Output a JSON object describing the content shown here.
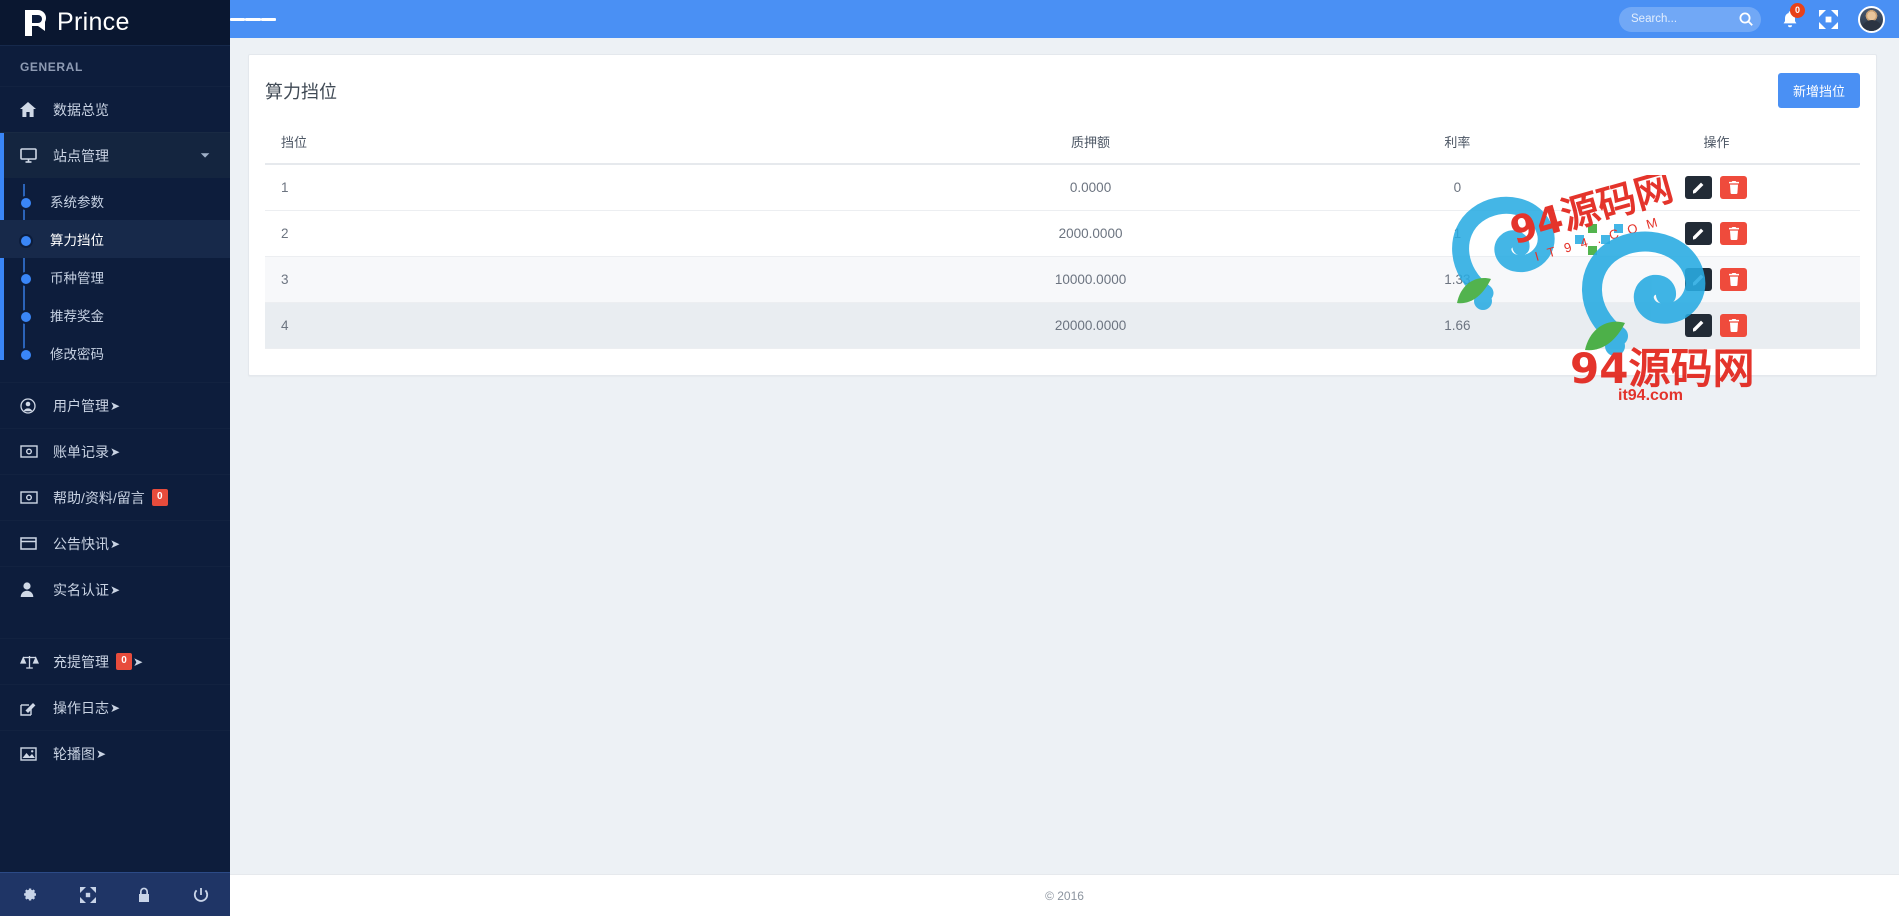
{
  "brand": {
    "name": "Prince"
  },
  "sidebar": {
    "section_label": "GENERAL",
    "items": [
      {
        "label": "数据总览",
        "icon": "home-icon",
        "caret": "",
        "badge": ""
      },
      {
        "label": "站点管理",
        "icon": "monitor-icon",
        "caret": "chevron-down",
        "badge": ""
      },
      {
        "label": "用户管理",
        "icon": "user-circle-icon",
        "caret": "chevron-right",
        "badge": ""
      },
      {
        "label": "账单记录",
        "icon": "money-icon",
        "caret": "chevron-right",
        "badge": ""
      },
      {
        "label": "帮助/资料/留言",
        "icon": "money-icon",
        "caret": "",
        "badge": "0"
      },
      {
        "label": "公告快讯",
        "icon": "window-icon",
        "caret": "chevron-right",
        "badge": ""
      },
      {
        "label": "实名认证",
        "icon": "person-icon",
        "caret": "chevron-right",
        "badge": ""
      },
      {
        "label": "充提管理",
        "icon": "balance-icon",
        "caret": "chevron-right",
        "badge": "0"
      },
      {
        "label": "操作日志",
        "icon": "edit-square-icon",
        "caret": "chevron-right",
        "badge": ""
      },
      {
        "label": "轮播图",
        "icon": "image-icon",
        "caret": "chevron-right",
        "badge": ""
      }
    ],
    "submenu": [
      {
        "label": "系统参数"
      },
      {
        "label": "算力挡位"
      },
      {
        "label": "币种管理"
      },
      {
        "label": "推荐奖金"
      },
      {
        "label": "修改密码"
      }
    ],
    "footer_icons": [
      "gear-icon",
      "expand-icon",
      "lock-icon",
      "power-icon"
    ]
  },
  "topbar": {
    "search_placeholder": "Search...",
    "search_value": "",
    "notification_count": "0"
  },
  "panel": {
    "title": "算力挡位",
    "add_button": "新增挡位"
  },
  "table": {
    "columns": [
      "挡位",
      "质押额",
      "利率",
      "操作"
    ],
    "rows": [
      {
        "level": "1",
        "amount": "0.0000",
        "rate": "0"
      },
      {
        "level": "2",
        "amount": "2000.0000",
        "rate": "1"
      },
      {
        "level": "3",
        "amount": "10000.0000",
        "rate": "1.33"
      },
      {
        "level": "4",
        "amount": "20000.0000",
        "rate": "1.66"
      }
    ]
  },
  "footer": {
    "copyright": "© 2016"
  },
  "watermark": {
    "title": "94源码网",
    "domain_small": "I T 9 4 . C O M",
    "domain": "it94.com"
  },
  "colors": {
    "accent": "#4a90f4",
    "sidebar_bg": "#0d1d3c",
    "danger": "#ef4b3c",
    "dark_btn": "#222b36"
  }
}
